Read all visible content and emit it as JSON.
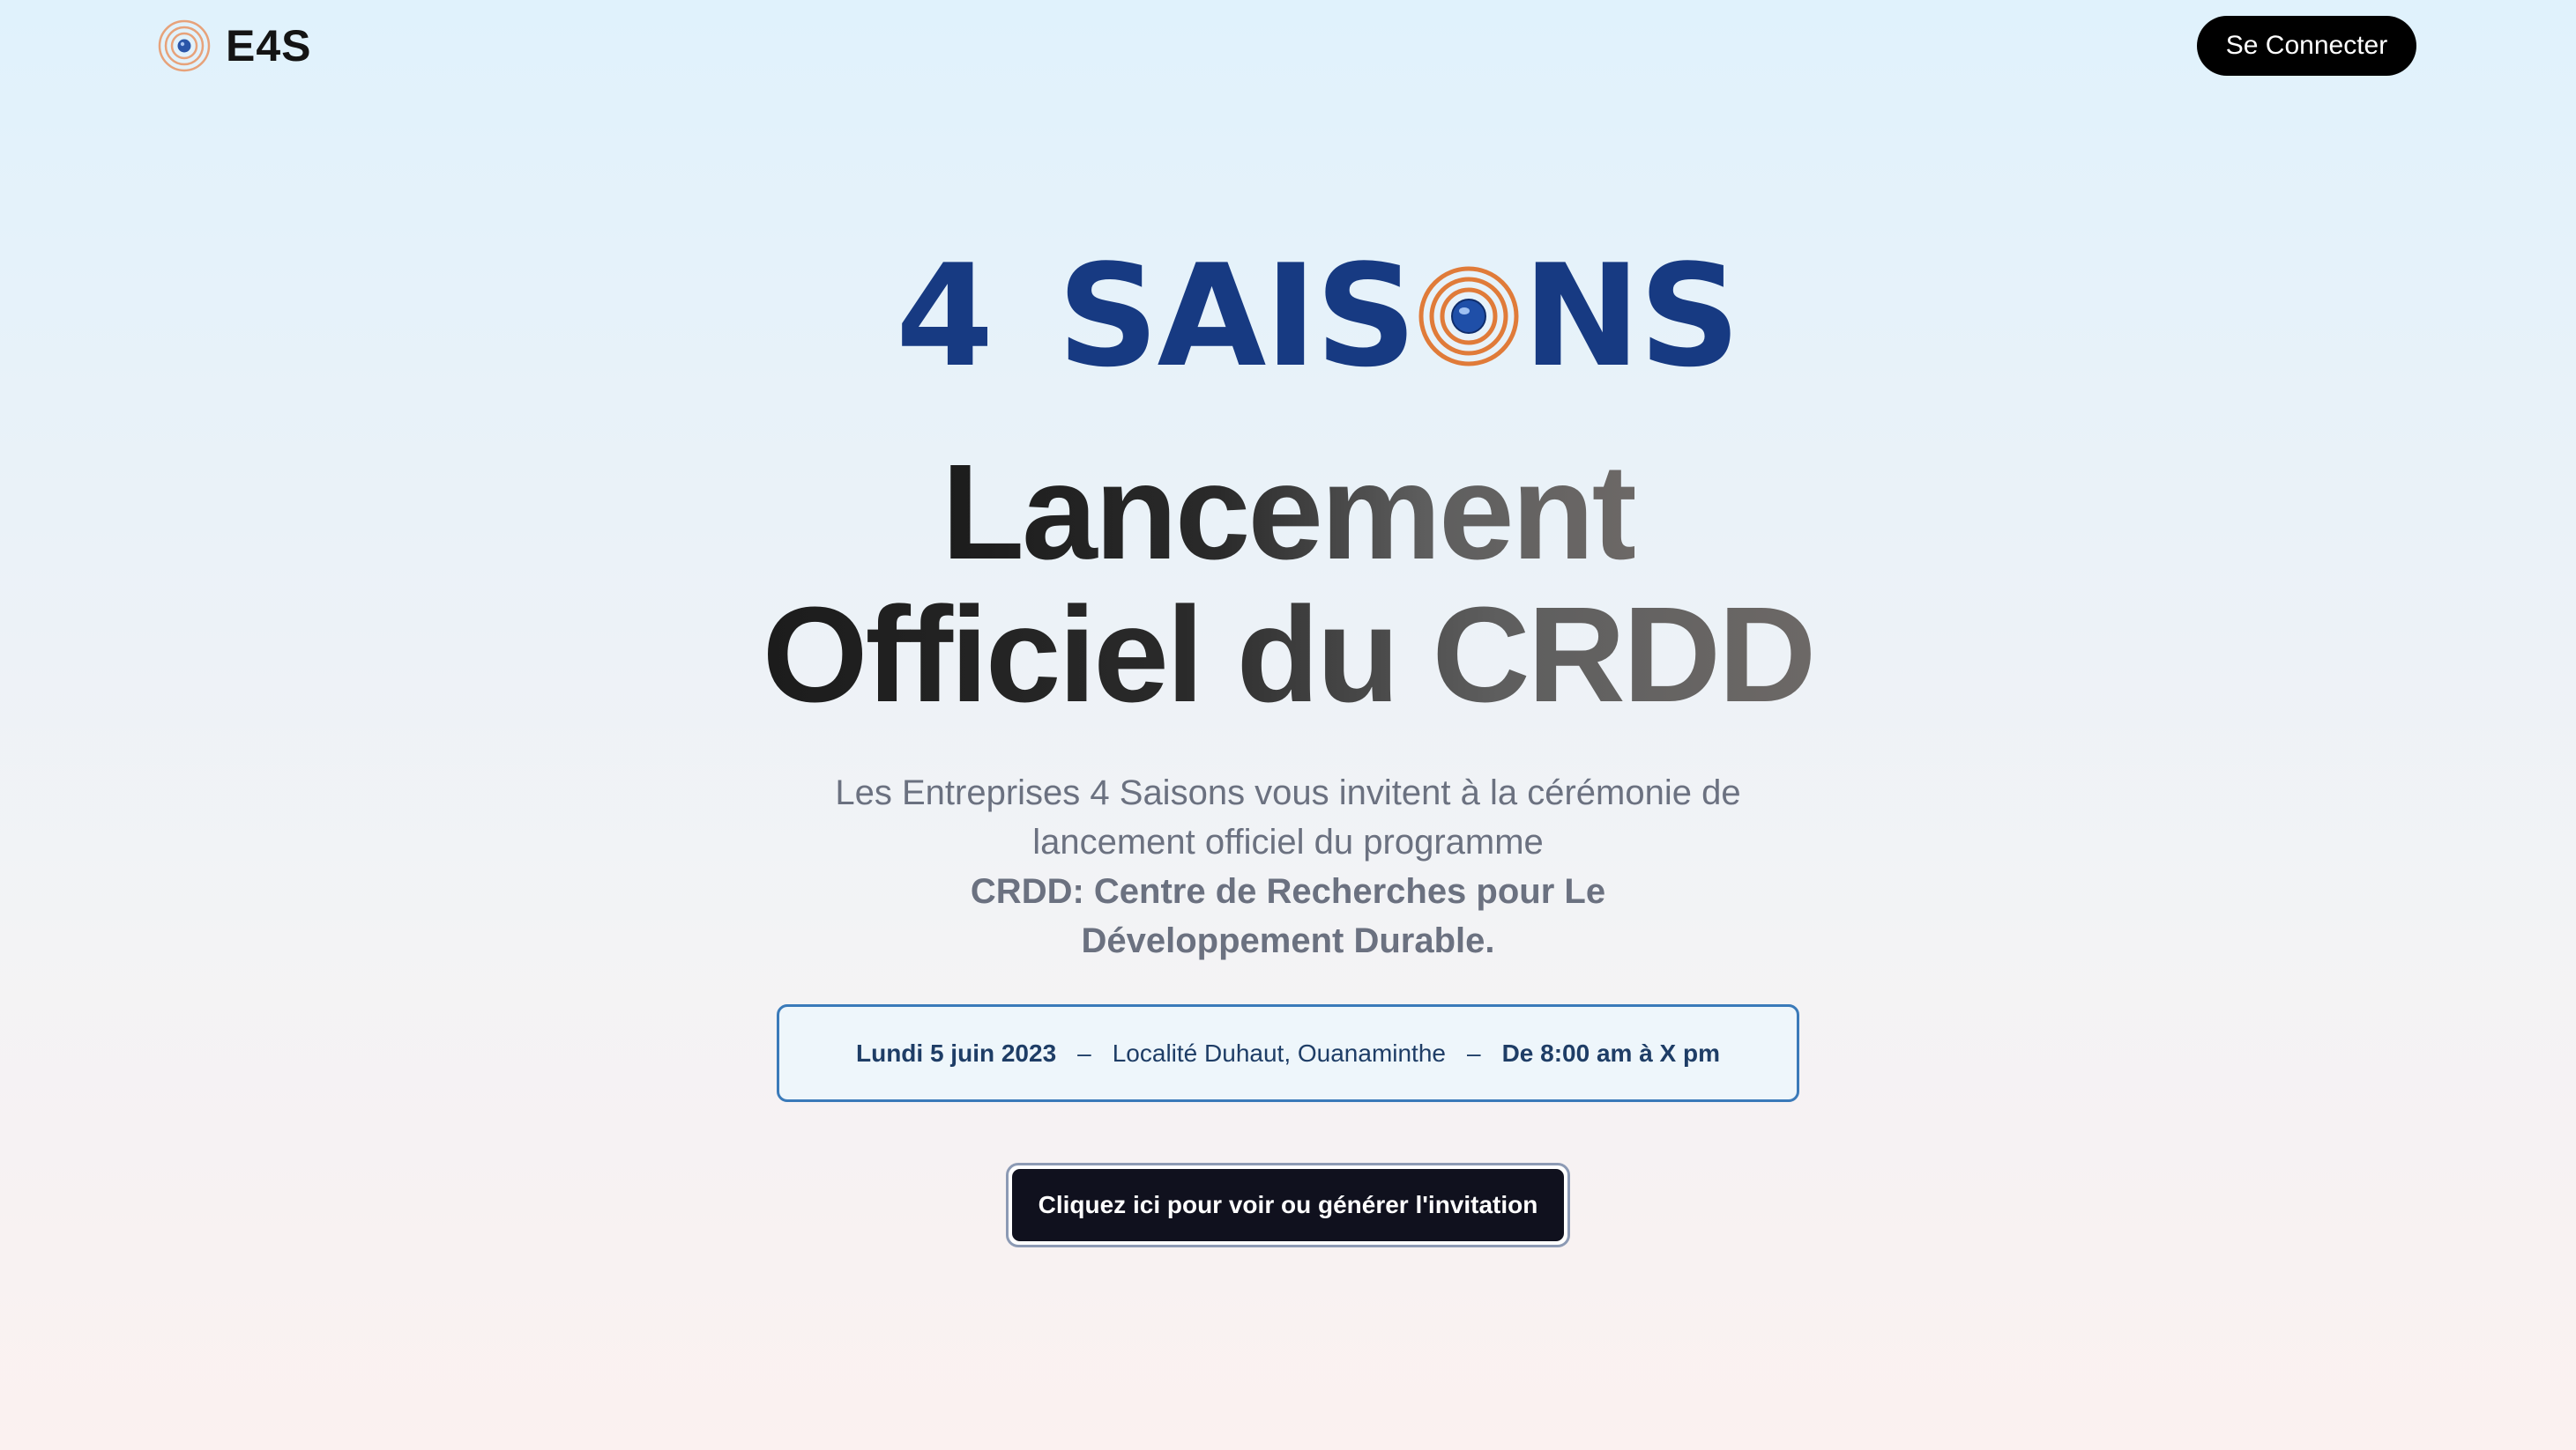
{
  "header": {
    "brand_name": "E4S",
    "login_label": "Se Connecter",
    "logo_icon": "spiral-eye-icon"
  },
  "event_logo": {
    "number": "4",
    "word_before_icon": "SAIS",
    "word_after_icon": "NS",
    "icon": "spiral-eye-icon"
  },
  "title": {
    "line1": "Lancement",
    "line2": "Officiel du CRDD"
  },
  "description": {
    "text": "Les Entreprises 4 Saisons vous invitent à la cérémonie de lancement officiel du programme",
    "bold": "CRDD: Centre de Recherches pour Le Développement Durable."
  },
  "info": {
    "date": "Lundi 5 juin 2023",
    "separator": "–",
    "location": "Localité Duhaut, Ouanaminthe",
    "time": "De 8:00 am à X pm"
  },
  "invite_button_label": "Cliquez ici pour voir ou générer l'invitation",
  "colors": {
    "logo_blue": "#173a82",
    "spiral_orange": "#e07b39",
    "button_dark": "#10111e",
    "info_border": "#3a7ab9"
  }
}
